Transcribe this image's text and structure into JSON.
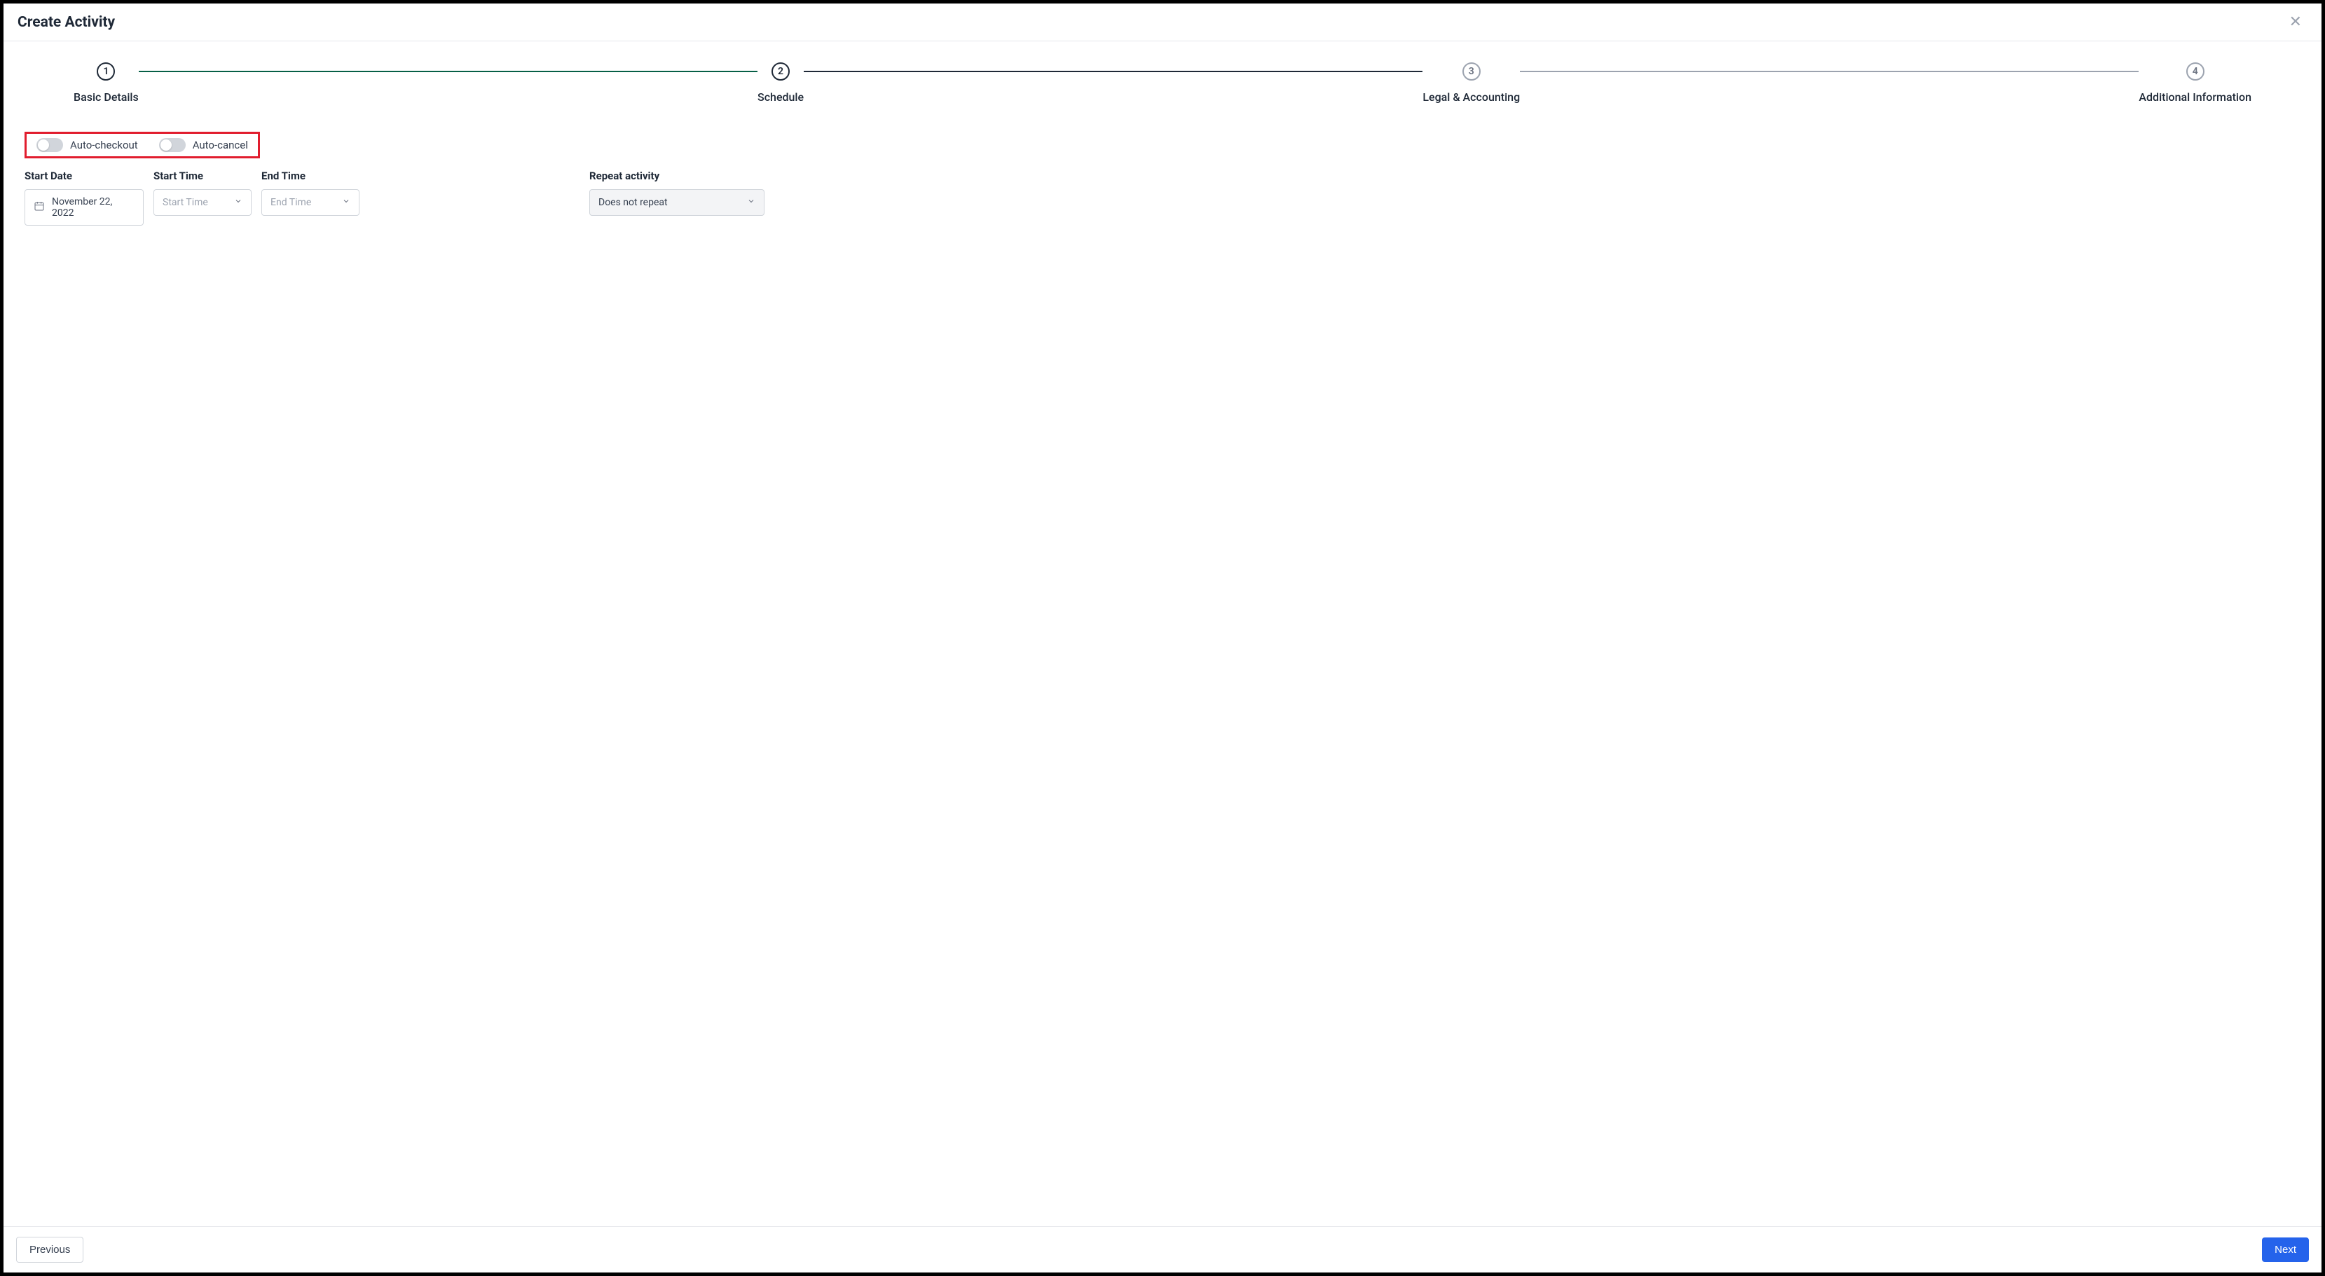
{
  "header": {
    "title": "Create Activity"
  },
  "stepper": {
    "steps": [
      {
        "num": "1",
        "label": "Basic Details"
      },
      {
        "num": "2",
        "label": "Schedule"
      },
      {
        "num": "3",
        "label": "Legal & Accounting"
      },
      {
        "num": "4",
        "label": "Additional Information"
      }
    ]
  },
  "toggles": {
    "auto_checkout": "Auto-checkout",
    "auto_cancel": "Auto-cancel"
  },
  "form": {
    "start_date_label": "Start Date",
    "start_date_value": "November 22, 2022",
    "start_time_label": "Start Time",
    "start_time_placeholder": "Start Time",
    "end_time_label": "End Time",
    "end_time_placeholder": "End Time",
    "repeat_label": "Repeat activity",
    "repeat_value": "Does not repeat"
  },
  "footer": {
    "previous": "Previous",
    "next": "Next"
  }
}
